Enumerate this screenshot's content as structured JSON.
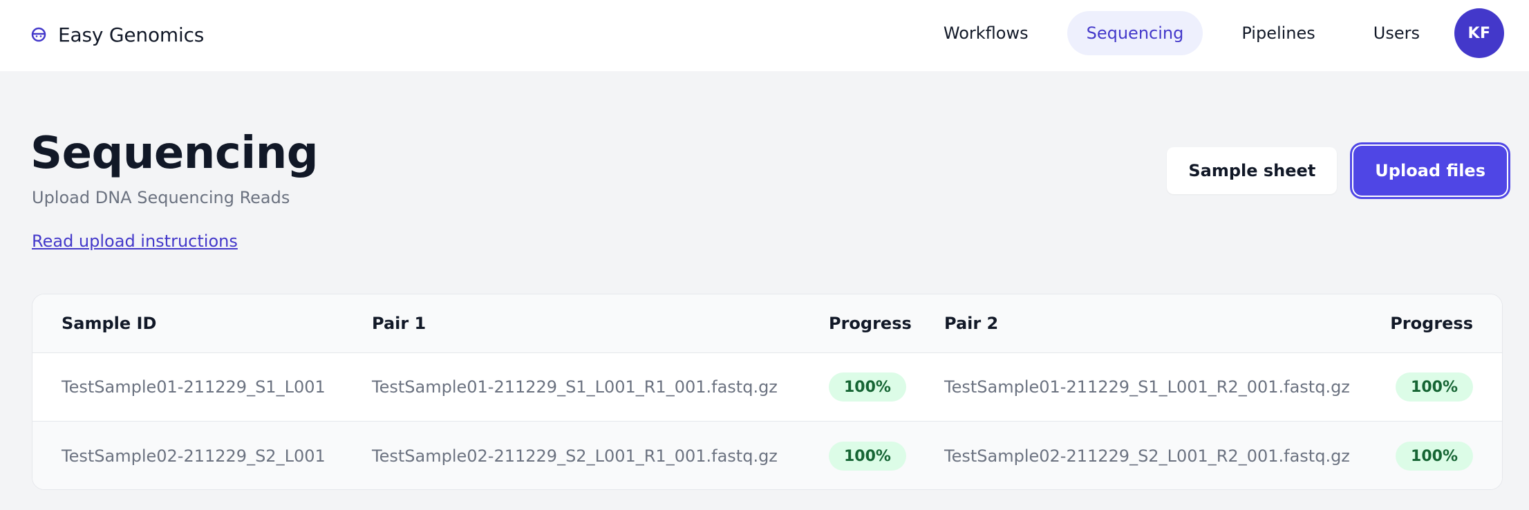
{
  "app": {
    "name": "Easy Genomics",
    "icon": "brand-face-icon",
    "accent_color": "#4338ca"
  },
  "nav": {
    "items": [
      {
        "label": "Workflows",
        "active": false
      },
      {
        "label": "Sequencing",
        "active": true
      },
      {
        "label": "Pipelines",
        "active": false
      },
      {
        "label": "Users",
        "active": false
      }
    ],
    "avatar_initials": "KF"
  },
  "header": {
    "title": "Sequencing",
    "subtitle": "Upload DNA Sequencing Reads",
    "instructions_link": "Read upload instructions"
  },
  "actions": {
    "sample_sheet_label": "Sample sheet",
    "upload_files_label": "Upload files"
  },
  "table": {
    "columns": [
      "Sample ID",
      "Pair 1",
      "Progress",
      "Pair 2",
      "Progress"
    ],
    "rows": [
      {
        "sample_id": "TestSample01-211229_S1_L001",
        "pair1": "TestSample01-211229_S1_L001_R1_001.fastq.gz",
        "pair1_progress": "100%",
        "pair2": "TestSample01-211229_S1_L001_R2_001.fastq.gz",
        "pair2_progress": "100%"
      },
      {
        "sample_id": "TestSample02-211229_S2_L001",
        "pair1": "TestSample02-211229_S2_L001_R1_001.fastq.gz",
        "pair1_progress": "100%",
        "pair2": "TestSample02-211229_S2_L001_R2_001.fastq.gz",
        "pair2_progress": "100%"
      }
    ]
  }
}
